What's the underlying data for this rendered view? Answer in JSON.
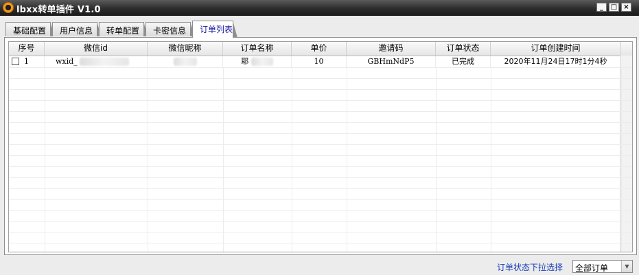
{
  "window": {
    "title": "lbxx转单插件 V1.0",
    "buttons": [
      "_",
      "□",
      "×"
    ]
  },
  "tabs": [
    "基础配置",
    "用户信息",
    "转单配置",
    "卡密信息",
    "订单列表"
  ],
  "active_tab_index": 4,
  "table": {
    "columns": [
      "序号",
      "微信id",
      "微信昵称",
      "订单名称",
      "单价",
      "邀请码",
      "订单状态",
      "订单创建时间"
    ],
    "rows": [
      {
        "index": "1",
        "wechat_id": "wxid_",
        "nickname": "",
        "order_name": "耶",
        "price": "10",
        "invite_code": "GBHmNdP5",
        "status": "已完成",
        "created_at": "2020年11月24日17时1分4秒"
      }
    ]
  },
  "filter": {
    "label": "订单状态下拉选择",
    "selected": "全部订单",
    "arrow_icon": "▼"
  }
}
